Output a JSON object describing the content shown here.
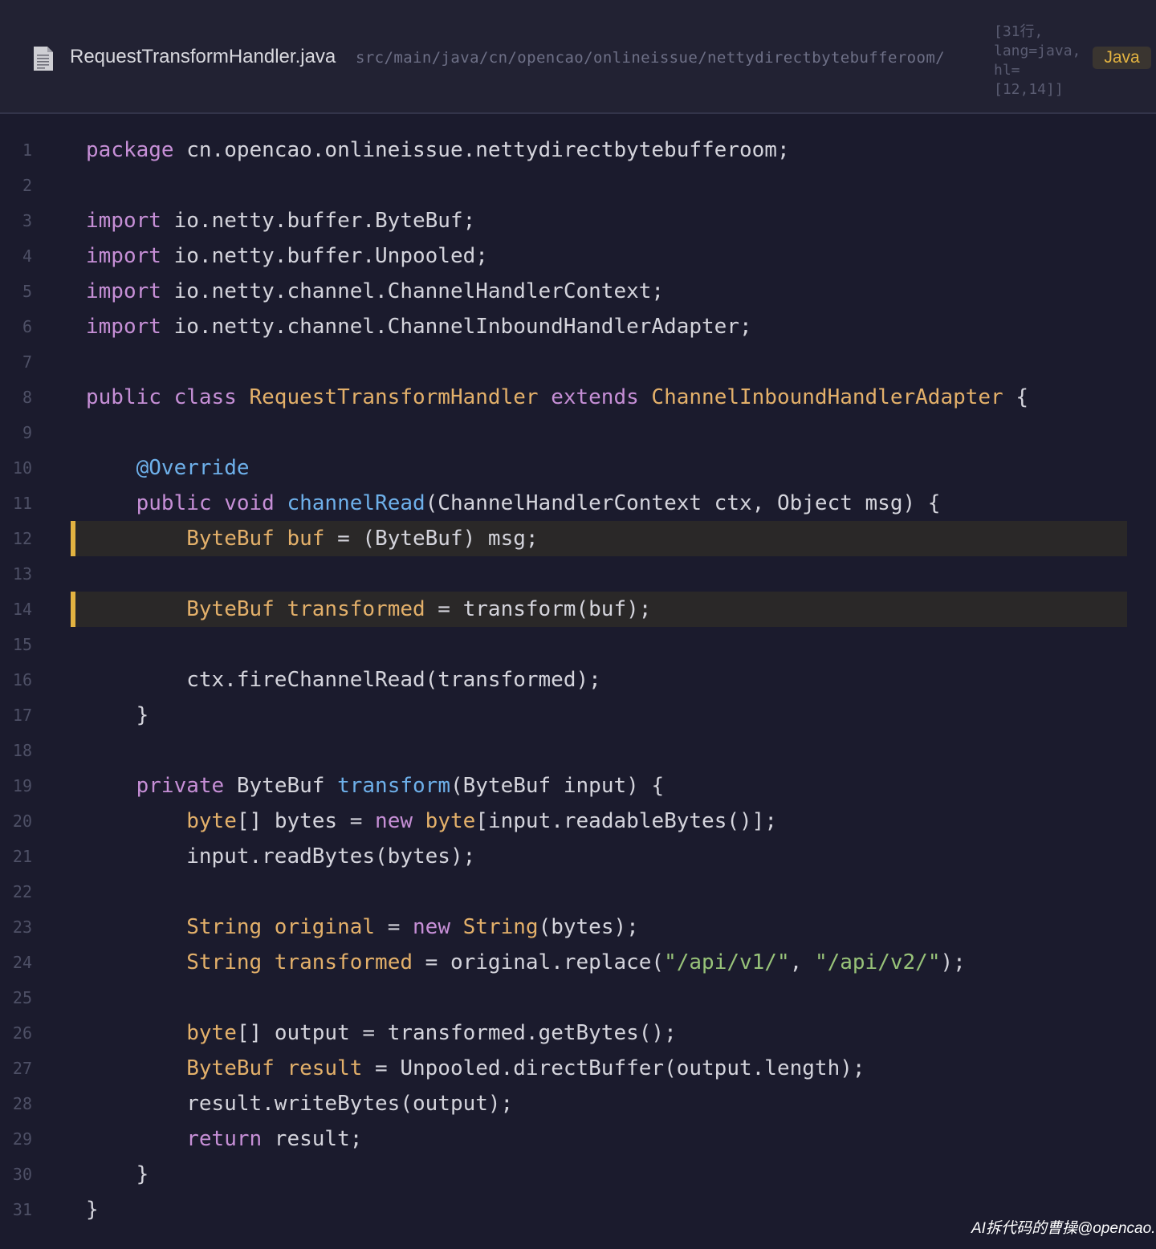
{
  "header": {
    "file_name": "RequestTransformHandler.java",
    "file_path": "src/main/java/cn/opencao/onlineissue/nettydirectbytebufferoom/",
    "meta": "[31行,\nlang=java,\nhl=\n[12,14]]",
    "language_badge": "Java",
    "icon": "document-icon"
  },
  "colors": {
    "background": "#1b1b2d",
    "keyword": "#c68fd6",
    "type": "#e3b06a",
    "function": "#6eb0ea",
    "string": "#98c379",
    "highlight_bar": "#e3b341"
  },
  "code": {
    "highlighted_lines": [
      12,
      14
    ],
    "lines": [
      {
        "n": "1",
        "tokens": [
          {
            "t": "package",
            "c": "kw"
          },
          {
            "t": " cn.opencao.onlineissue.nettydirectbytebufferoom;"
          }
        ]
      },
      {
        "n": "2",
        "tokens": []
      },
      {
        "n": "3",
        "tokens": [
          {
            "t": "import",
            "c": "kw"
          },
          {
            "t": " io.netty.buffer.ByteBuf;"
          }
        ]
      },
      {
        "n": "4",
        "tokens": [
          {
            "t": "import",
            "c": "kw"
          },
          {
            "t": " io.netty.buffer.Unpooled;"
          }
        ]
      },
      {
        "n": "5",
        "tokens": [
          {
            "t": "import",
            "c": "kw"
          },
          {
            "t": " io.netty.channel.ChannelHandlerContext;"
          }
        ]
      },
      {
        "n": "6",
        "tokens": [
          {
            "t": "import",
            "c": "kw"
          },
          {
            "t": " io.netty.channel.ChannelInboundHandlerAdapter;"
          }
        ]
      },
      {
        "n": "7",
        "tokens": []
      },
      {
        "n": "8",
        "tokens": [
          {
            "t": "public class",
            "c": "kw"
          },
          {
            "t": " "
          },
          {
            "t": "RequestTransformHandler",
            "c": "ty"
          },
          {
            "t": " "
          },
          {
            "t": "extends",
            "c": "kw"
          },
          {
            "t": " "
          },
          {
            "t": "ChannelInboundHandlerAdapter",
            "c": "ty"
          },
          {
            "t": " {"
          }
        ]
      },
      {
        "n": "9",
        "tokens": []
      },
      {
        "n": "10",
        "tokens": [
          {
            "t": "    "
          },
          {
            "t": "@Override",
            "c": "an"
          }
        ]
      },
      {
        "n": "11",
        "tokens": [
          {
            "t": "    "
          },
          {
            "t": "public void",
            "c": "kw"
          },
          {
            "t": " "
          },
          {
            "t": "channelRead",
            "c": "fn"
          },
          {
            "t": "(ChannelHandlerContext ctx, Object msg) {"
          }
        ]
      },
      {
        "n": "12",
        "tokens": [
          {
            "t": "        "
          },
          {
            "t": "ByteBuf buf",
            "c": "ty"
          },
          {
            "t": " = (ByteBuf) msg;"
          }
        ]
      },
      {
        "n": "13",
        "tokens": []
      },
      {
        "n": "14",
        "tokens": [
          {
            "t": "        "
          },
          {
            "t": "ByteBuf transformed",
            "c": "ty"
          },
          {
            "t": " = transform(buf);"
          }
        ]
      },
      {
        "n": "15",
        "tokens": []
      },
      {
        "n": "16",
        "tokens": [
          {
            "t": "        ctx.fireChannelRead(transformed);"
          }
        ]
      },
      {
        "n": "17",
        "tokens": [
          {
            "t": "    }"
          }
        ]
      },
      {
        "n": "18",
        "tokens": []
      },
      {
        "n": "19",
        "tokens": [
          {
            "t": "    "
          },
          {
            "t": "private",
            "c": "kw"
          },
          {
            "t": " ByteBuf "
          },
          {
            "t": "transform",
            "c": "fn"
          },
          {
            "t": "(ByteBuf input) {"
          }
        ]
      },
      {
        "n": "20",
        "tokens": [
          {
            "t": "        "
          },
          {
            "t": "byte",
            "c": "ty"
          },
          {
            "t": "[] bytes = "
          },
          {
            "t": "new",
            "c": "kw"
          },
          {
            "t": " "
          },
          {
            "t": "byte",
            "c": "ty"
          },
          {
            "t": "[input.readableBytes()];"
          }
        ]
      },
      {
        "n": "21",
        "tokens": [
          {
            "t": "        input.readBytes(bytes);"
          }
        ]
      },
      {
        "n": "22",
        "tokens": []
      },
      {
        "n": "23",
        "tokens": [
          {
            "t": "        "
          },
          {
            "t": "String original",
            "c": "ty"
          },
          {
            "t": " = "
          },
          {
            "t": "new",
            "c": "kw"
          },
          {
            "t": " "
          },
          {
            "t": "String",
            "c": "ty"
          },
          {
            "t": "(bytes);"
          }
        ]
      },
      {
        "n": "24",
        "tokens": [
          {
            "t": "        "
          },
          {
            "t": "String transformed",
            "c": "ty"
          },
          {
            "t": " = original.replace("
          },
          {
            "t": "\"/api/v1/\"",
            "c": "st"
          },
          {
            "t": ", "
          },
          {
            "t": "\"/api/v2/\"",
            "c": "st"
          },
          {
            "t": ");"
          }
        ]
      },
      {
        "n": "25",
        "tokens": []
      },
      {
        "n": "26",
        "tokens": [
          {
            "t": "        "
          },
          {
            "t": "byte",
            "c": "ty"
          },
          {
            "t": "[] output = transformed.getBytes();"
          }
        ]
      },
      {
        "n": "27",
        "tokens": [
          {
            "t": "        "
          },
          {
            "t": "ByteBuf result",
            "c": "ty"
          },
          {
            "t": " = Unpooled.directBuffer(output.length);"
          }
        ]
      },
      {
        "n": "28",
        "tokens": [
          {
            "t": "        result.writeBytes(output);"
          }
        ]
      },
      {
        "n": "29",
        "tokens": [
          {
            "t": "        "
          },
          {
            "t": "return",
            "c": "kw"
          },
          {
            "t": " result;"
          }
        ]
      },
      {
        "n": "30",
        "tokens": [
          {
            "t": "    }"
          }
        ]
      },
      {
        "n": "31",
        "tokens": [
          {
            "t": "}"
          }
        ]
      }
    ]
  },
  "watermark": "AI拆代码的曹操@opencao.cn"
}
